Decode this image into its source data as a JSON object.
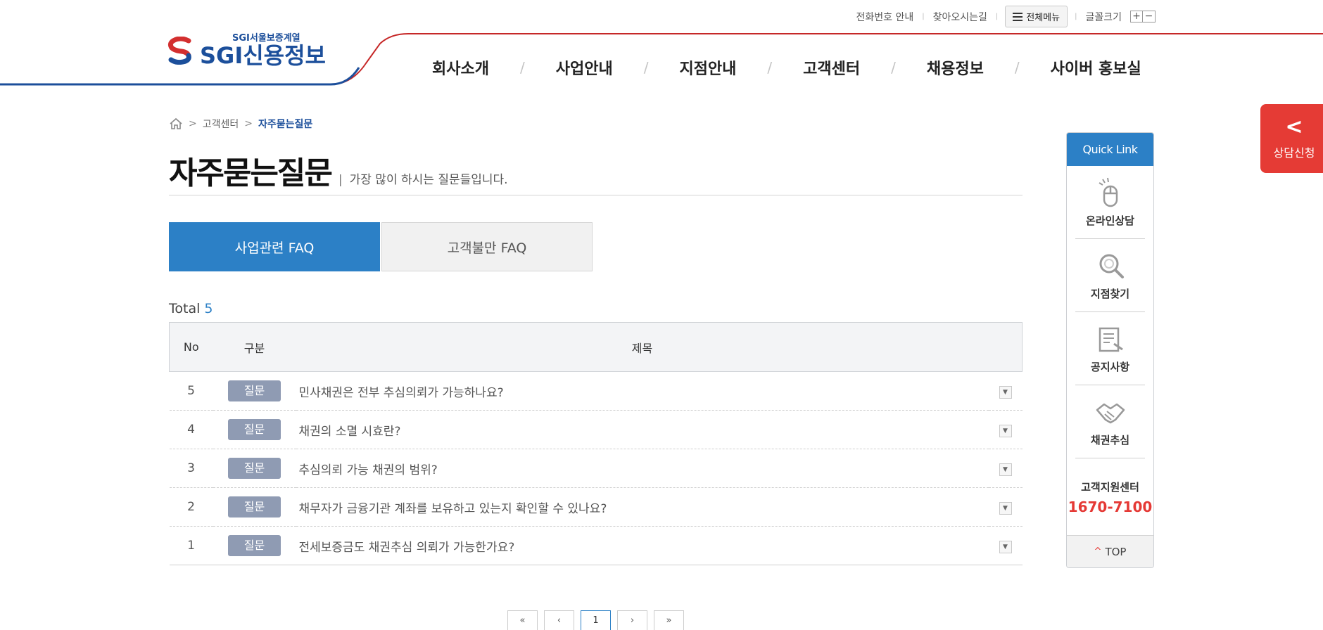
{
  "util": {
    "phone_info": "전화번호 안내",
    "directions": "찾아오시는길",
    "all_menu": "전체메뉴",
    "font_size": "글꼴크기",
    "font_plus": "+",
    "font_minus": "−"
  },
  "logo": {
    "sub": "SGI서울보증계열",
    "sgi": "SGI",
    "main": "신용정보"
  },
  "gnb": {
    "items": [
      "회사소개",
      "사업안내",
      "지점안내",
      "고객센터",
      "채용정보",
      "사이버 홍보실"
    ],
    "separator": "/"
  },
  "breadcrumb": {
    "level1": "고객센터",
    "current": "자주묻는질문",
    "separator": ">"
  },
  "page": {
    "title": "자주묻는질문",
    "bar": "|",
    "desc": "가장 많이 하시는 질문들입니다."
  },
  "tabs": {
    "active": "사업관련 FAQ",
    "inactive": "고객불만 FAQ"
  },
  "total": {
    "label": "Total",
    "count": "5"
  },
  "table": {
    "headers": {
      "no": "No",
      "category": "구분",
      "title": "제목"
    },
    "rows": [
      {
        "no": "5",
        "category": "질문",
        "title": "민사채권은 전부 추심의뢰가 가능하나요?"
      },
      {
        "no": "4",
        "category": "질문",
        "title": "채권의 소멸 시효란?"
      },
      {
        "no": "3",
        "category": "질문",
        "title": "추심의뢰 가능 채권의 범위?"
      },
      {
        "no": "2",
        "category": "질문",
        "title": "채무자가 금융기관 계좌를 보유하고 있는지 확인할 수 있나요?"
      },
      {
        "no": "1",
        "category": "질문",
        "title": "전세보증금도 채권추심 의뢰가 가능한가요?"
      }
    ],
    "arrow": "▼"
  },
  "pagination": {
    "first": "«",
    "prev": "‹",
    "current": "1",
    "next": "›",
    "last": "»"
  },
  "quick": {
    "title": "Quick Link",
    "items": [
      "온라인상담",
      "지점찾기",
      "공지사항",
      "채권추심"
    ],
    "center_label": "고객지원센터",
    "center_phone": "1670-7100",
    "top": "TOP",
    "top_caret": "^"
  },
  "consult": {
    "chevron": "<",
    "label": "상담신청"
  },
  "colors": {
    "brand_blue": "#1c4f9b",
    "accent_blue": "#2c80c6",
    "accent_red": "#e53935",
    "badge": "#8f9bb3"
  }
}
